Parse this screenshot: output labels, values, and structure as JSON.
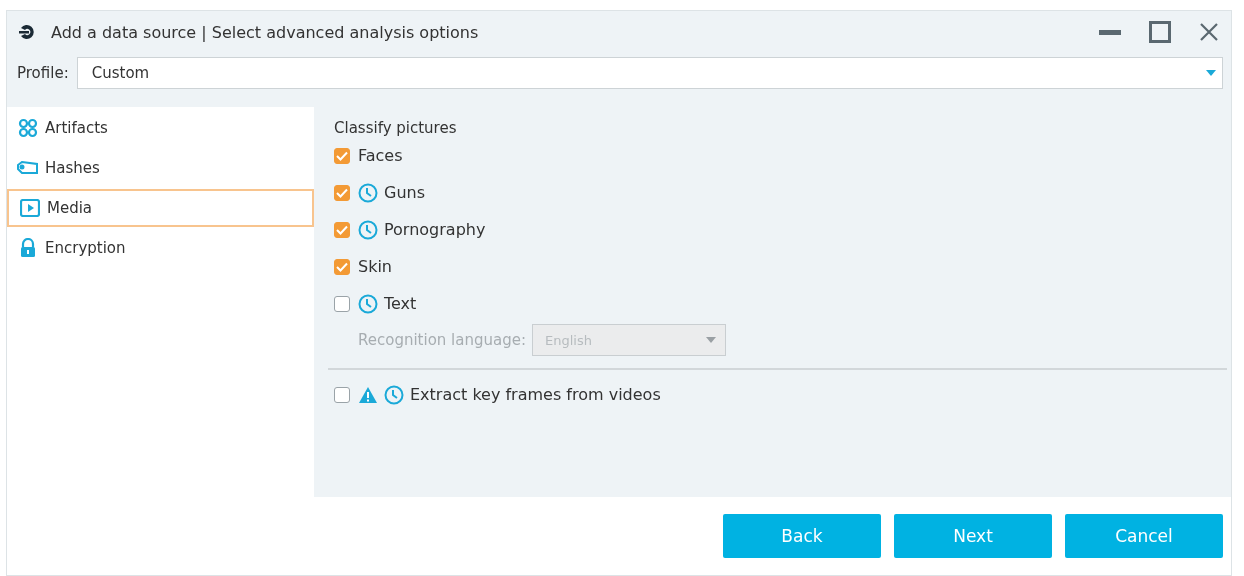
{
  "window": {
    "title": "Add a data source | Select advanced analysis options"
  },
  "profile": {
    "label": "Profile:",
    "value": "Custom"
  },
  "sidebar": {
    "items": [
      {
        "label": "Artifacts",
        "selected": false
      },
      {
        "label": "Hashes",
        "selected": false
      },
      {
        "label": "Media",
        "selected": true
      },
      {
        "label": "Encryption",
        "selected": false
      }
    ]
  },
  "section": {
    "title": "Classify pictures",
    "options": [
      {
        "label": "Faces",
        "checked": true,
        "clock": false,
        "warning": false
      },
      {
        "label": "Guns",
        "checked": true,
        "clock": true,
        "warning": false
      },
      {
        "label": "Pornography",
        "checked": true,
        "clock": true,
        "warning": false
      },
      {
        "label": "Skin",
        "checked": true,
        "clock": false,
        "warning": false
      },
      {
        "label": "Text",
        "checked": false,
        "clock": true,
        "warning": false
      }
    ],
    "language": {
      "label": "Recognition language:",
      "value": "English",
      "disabled": true
    }
  },
  "video_options": [
    {
      "label": "Extract key frames from videos",
      "checked": false,
      "clock": true,
      "warning": true
    }
  ],
  "buttons": [
    "Back",
    "Next",
    "Cancel"
  ]
}
